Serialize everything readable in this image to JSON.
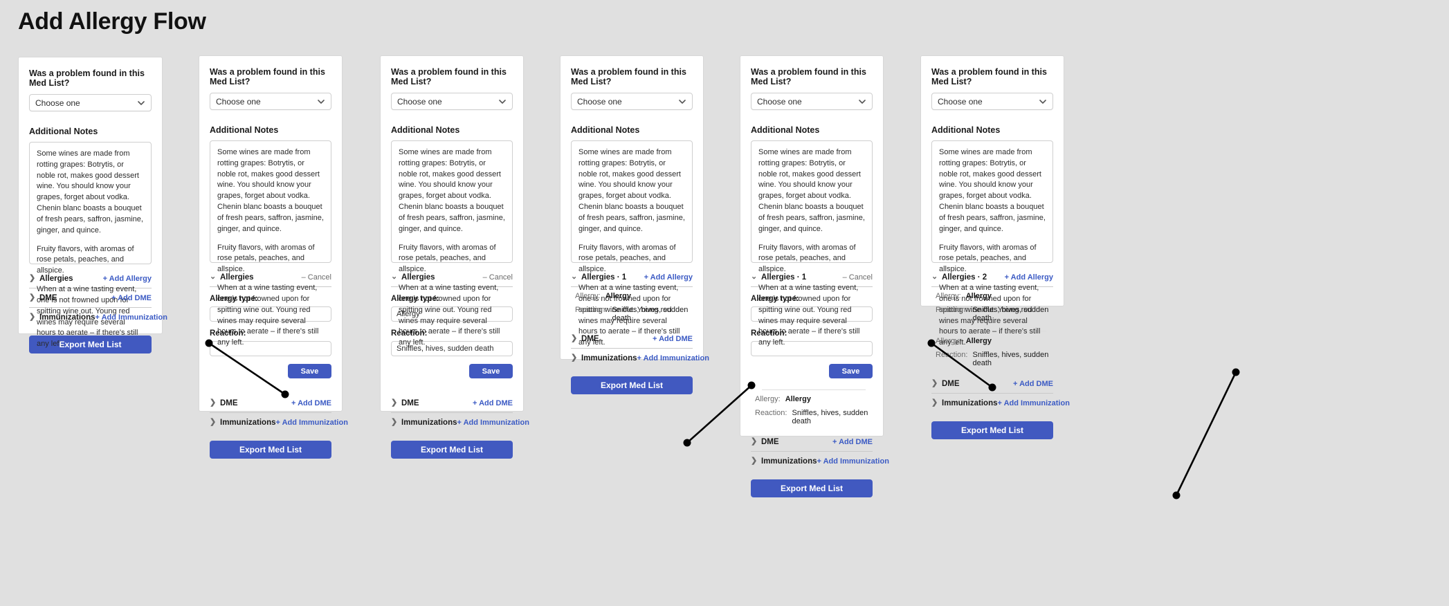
{
  "page": {
    "title": "Add Allergy Flow"
  },
  "common": {
    "question_label": "Was a problem found in this Med List?",
    "select_value": "Choose one",
    "notes_label": "Additional Notes",
    "notes_p1": "Some wines are made from rotting grapes: Botrytis, or noble rot, makes good dessert wine. You should know your grapes, forget about vodka. Chenin blanc boasts a bouquet of fresh pears, saffron, jasmine, ginger, and quince.",
    "notes_p2": "Fruity flavors, with aromas of rose petals, peaches, and allspice.",
    "notes_p3": "When at a wine tasting event, one is not frowned upon for spitting wine out. Young red wines may require several hours to aerate – if there's still any left.",
    "allergies_label": "Allergies",
    "allergies_label_1": "Allergies · 1",
    "allergies_label_2": "Allergies · 2",
    "dme_label": "DME",
    "immunizations_label": "Immunizations",
    "add_allergy": "+ Add Allergy",
    "add_dme": "+ Add DME",
    "add_immunization": "+ Add Immunization",
    "cancel": "– Cancel",
    "allergy_type_label": "Allergy type:",
    "reaction_label": "Reaction:",
    "save": "Save",
    "export": "Export Med List",
    "entry_allergy_key": "Allergy:",
    "entry_reaction_key": "Reaction:",
    "entry_allergy_value": "Allergy",
    "entry_reaction_value": "Sniffles, hives, sudden death",
    "input_allergy_value": "Allergy",
    "input_reaction_value": "Sniffles, hives, sudden death",
    "empty_value": "",
    "caret_collapsed": "❯",
    "caret_expanded": "⌄"
  },
  "colors": {
    "accent": "#4159c0",
    "link": "#3c5bc4",
    "page_bg": "#e0e0e0",
    "card_bg": "#ffffff",
    "muted": "#6b6b6b"
  },
  "cards": [
    {
      "id": "card-1",
      "state": "collapsed"
    },
    {
      "id": "card-2",
      "state": "expanded-empty"
    },
    {
      "id": "card-3",
      "state": "expanded-filled"
    },
    {
      "id": "card-4",
      "state": "saved-one"
    },
    {
      "id": "card-5",
      "state": "expanded-empty-with-one"
    },
    {
      "id": "card-6",
      "state": "saved-two"
    }
  ]
}
